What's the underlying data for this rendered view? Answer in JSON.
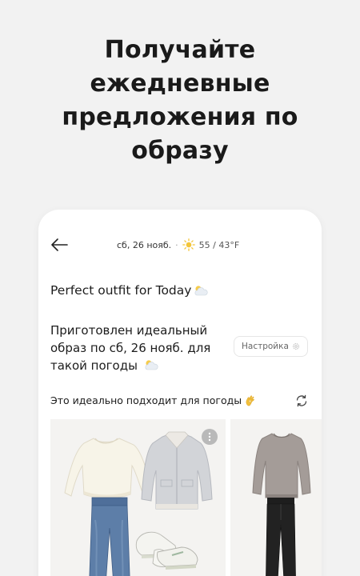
{
  "headline": {
    "line1": "Получайте",
    "line2": "ежедневные",
    "line3": "предложения по",
    "line4": "образу"
  },
  "topbar": {
    "date": "сб, 26 нояб.",
    "separator": "·",
    "temperature": "55 / 43°F"
  },
  "content": {
    "title": "Perfect outfit for Today",
    "description": "Приготовлен идеальный образ по сб, 26 нояб. для такой погоды",
    "settings_label": "Настройка",
    "section_label": "Это идеально подходит для погоды"
  },
  "icons": {
    "back": "arrow-left-icon",
    "weather": "sun-icon",
    "cloud": "sun-cloud-icon",
    "settings": "gear-icon",
    "hand": "ok-hand-icon",
    "refresh": "refresh-icon",
    "more": "more-vertical-icon"
  },
  "outfits": [
    {
      "items": [
        "cream-sweater",
        "grey-shearling-jacket",
        "blue-jeans",
        "white-sneakers"
      ]
    },
    {
      "items": [
        "grey-sweater",
        "black-trousers"
      ]
    }
  ],
  "colors": {
    "background": "#f2f2f2",
    "card": "#ffffff",
    "sun": "#f3c53a",
    "accent_text": "#1c1c1c"
  }
}
